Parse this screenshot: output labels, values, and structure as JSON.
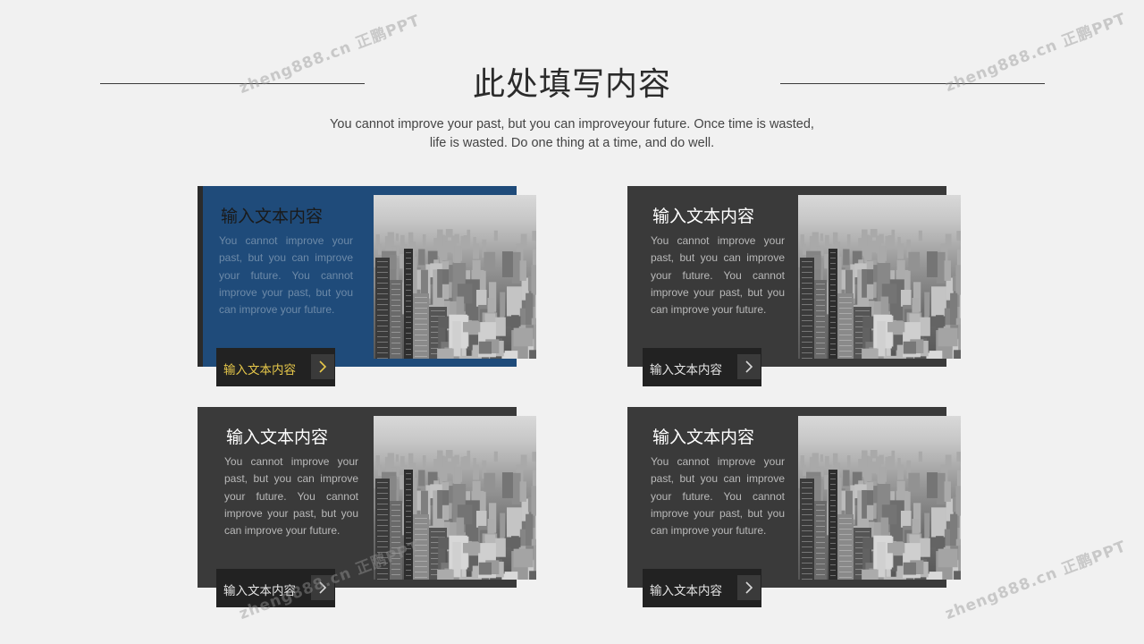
{
  "header": {
    "title": "此处填写内容",
    "subtitle_line1": "You cannot improve your past, but you can improveyour future. Once time is wasted,",
    "subtitle_line2": "life is wasted. Do one thing at a time, and do well."
  },
  "cards": [
    {
      "title": "输入文本内容",
      "body": "You cannot improve your past, but you can improve your future. You cannot improve your past, but you can improve your future.",
      "button_label": "输入文本内容",
      "icon": "chevron-right-icon",
      "photo": "city-skyline-photo"
    },
    {
      "title": "输入文本内容",
      "body": "You cannot improve your past, but you can improve your future. You cannot improve your past, but you can improve your future.",
      "button_label": "输入文本内容",
      "icon": "chevron-right-icon",
      "photo": "city-skyline-photo"
    },
    {
      "title": "输入文本内容",
      "body": "You cannot improve your past, but you can improve your future. You cannot improve your past, but you can improve your future.",
      "button_label": "输入文本内容",
      "icon": "chevron-right-icon",
      "photo": "city-skyline-photo"
    },
    {
      "title": "输入文本内容",
      "body": "You cannot improve your past, but you can improve your future. You cannot improve your past, but you can improve your future.",
      "button_label": "输入文本内容",
      "icon": "chevron-right-icon",
      "photo": "city-skyline-photo"
    }
  ],
  "watermark": "zheng888.cn 正鹏PPT",
  "colors": {
    "background": "#f1f1f1",
    "accent_blue": "#1f4b7a",
    "dark_panel": "#3a3a3a",
    "button_bg": "#222222",
    "highlight_yellow": "#e7c84a"
  }
}
